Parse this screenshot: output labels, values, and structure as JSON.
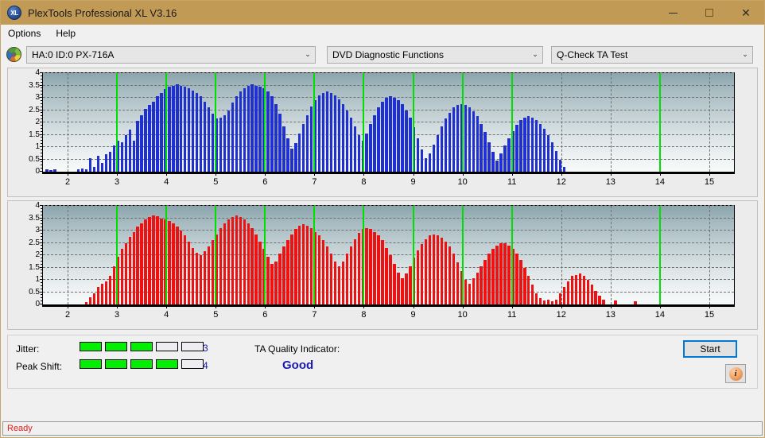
{
  "window": {
    "title": "PlexTools Professional XL V3.16",
    "app_icon": "XL",
    "minimize": "—",
    "maximize": "□",
    "close": "✕"
  },
  "menu": [
    {
      "label": "Options"
    },
    {
      "label": "Help"
    }
  ],
  "toolbar": {
    "drive_icon": "disc-icon",
    "drive_value": "HA:0 ID:0  PX-716A",
    "function_value": "DVD Diagnostic Functions",
    "test_value": "Q-Check TA Test",
    "chevron": "⌄"
  },
  "info": {
    "jitter_label": "Jitter:",
    "jitter_value": "3",
    "jitter_segments": 5,
    "jitter_filled": 3,
    "peak_label": "Peak Shift:",
    "peak_value": "4",
    "peak_segments": 5,
    "peak_filled": 4,
    "ta_label": "TA Quality Indicator:",
    "ta_value": "Good",
    "start_label": "Start",
    "info_glyph": "i",
    "colors": {
      "segment_on": "#00f000",
      "value_text": "#1a1ab0",
      "ta_text": "#1a1aaa",
      "accent": "#0078d7"
    }
  },
  "status": {
    "text": "Ready"
  },
  "chart_data": [
    {
      "type": "bar",
      "name": "jitter-chart",
      "title": "",
      "xlabel": "",
      "ylabel": "",
      "color": "#1f2fd0",
      "xlim": [
        1.5,
        15.5
      ],
      "ylim": [
        0,
        4
      ],
      "grid": true,
      "yticks": [
        0,
        0.5,
        1,
        1.5,
        2,
        2.5,
        3,
        3.5,
        4
      ],
      "xticks": [
        2,
        3,
        4,
        5,
        6,
        7,
        8,
        9,
        10,
        11,
        12,
        13,
        14,
        15
      ],
      "markers": [
        3,
        4,
        5,
        6,
        7,
        8,
        9,
        10,
        11,
        14
      ],
      "x": [
        1.58,
        1.66,
        1.74,
        1.82,
        1.9,
        1.98,
        2.06,
        2.14,
        2.22,
        2.3,
        2.38,
        2.46,
        2.54,
        2.62,
        2.7,
        2.78,
        2.86,
        2.94,
        3.02,
        3.1,
        3.18,
        3.26,
        3.34,
        3.42,
        3.5,
        3.58,
        3.66,
        3.74,
        3.82,
        3.9,
        3.98,
        4.06,
        4.14,
        4.22,
        4.3,
        4.38,
        4.46,
        4.54,
        4.62,
        4.7,
        4.78,
        4.86,
        4.94,
        5.02,
        5.1,
        5.18,
        5.26,
        5.34,
        5.42,
        5.5,
        5.58,
        5.66,
        5.74,
        5.82,
        5.9,
        5.98,
        6.06,
        6.14,
        6.22,
        6.3,
        6.38,
        6.46,
        6.54,
        6.62,
        6.7,
        6.78,
        6.86,
        6.94,
        7.02,
        7.1,
        7.18,
        7.26,
        7.34,
        7.42,
        7.5,
        7.58,
        7.66,
        7.74,
        7.82,
        7.9,
        7.98,
        8.06,
        8.14,
        8.22,
        8.3,
        8.38,
        8.46,
        8.54,
        8.62,
        8.7,
        8.78,
        8.86,
        8.94,
        9.02,
        9.1,
        9.18,
        9.26,
        9.34,
        9.42,
        9.5,
        9.58,
        9.66,
        9.74,
        9.82,
        9.9,
        9.98,
        10.06,
        10.14,
        10.22,
        10.3,
        10.38,
        10.46,
        10.54,
        10.62,
        10.7,
        10.78,
        10.86,
        10.94,
        11.02,
        11.1,
        11.18,
        11.26,
        11.34,
        11.42,
        11.5,
        11.58,
        11.66,
        11.74,
        11.82,
        11.9,
        11.98,
        12.06,
        12.14,
        12.22,
        12.3,
        12.38,
        12.46,
        12.54,
        12.62,
        12.7,
        12.78,
        12.86,
        12.94,
        13.02,
        13.1,
        13.18,
        13.26,
        13.34,
        13.42,
        13.5,
        13.58,
        13.66,
        13.74,
        13.82,
        13.9,
        13.98,
        14.06,
        14.14,
        14.22,
        14.3,
        14.38,
        14.46,
        14.54,
        14.62,
        14.7,
        14.78,
        14.86,
        14.94,
        15.02,
        15.1,
        15.18,
        15.26,
        15.34,
        15.42
      ],
      "values": [
        0.1,
        0.08,
        0.1,
        0.0,
        0.0,
        0.0,
        0.0,
        0.0,
        0.1,
        0.12,
        0.1,
        0.55,
        0.2,
        0.65,
        0.35,
        0.7,
        0.8,
        1.05,
        1.25,
        1.2,
        1.5,
        1.7,
        1.25,
        2.05,
        2.3,
        2.55,
        2.7,
        2.85,
        3.05,
        3.2,
        3.35,
        3.45,
        3.5,
        3.55,
        3.5,
        3.45,
        3.4,
        3.3,
        3.2,
        3.05,
        2.85,
        2.6,
        2.35,
        2.15,
        2.2,
        2.3,
        2.5,
        2.8,
        3.05,
        3.25,
        3.4,
        3.5,
        3.55,
        3.5,
        3.45,
        3.4,
        3.25,
        3.05,
        2.75,
        2.35,
        1.85,
        1.35,
        0.95,
        1.15,
        1.55,
        1.95,
        2.3,
        2.65,
        2.9,
        3.1,
        3.2,
        3.25,
        3.2,
        3.1,
        2.95,
        2.75,
        2.5,
        2.2,
        1.85,
        1.5,
        1.25,
        1.55,
        1.95,
        2.3,
        2.6,
        2.85,
        3.0,
        3.05,
        3.0,
        2.9,
        2.75,
        2.5,
        2.2,
        1.8,
        1.35,
        0.9,
        0.55,
        0.75,
        1.1,
        1.5,
        1.85,
        2.15,
        2.4,
        2.6,
        2.7,
        2.75,
        2.7,
        2.6,
        2.45,
        2.25,
        1.95,
        1.6,
        1.2,
        0.8,
        0.45,
        0.75,
        1.05,
        1.35,
        1.65,
        1.9,
        2.1,
        2.2,
        2.25,
        2.2,
        2.1,
        1.95,
        1.75,
        1.5,
        1.2,
        0.85,
        0.5,
        0.2,
        0.0,
        0.0,
        0.0,
        0.0,
        0.0,
        0.0,
        0.0,
        0.0,
        0.0,
        0.0,
        0.0,
        0.0,
        0.0,
        0.0,
        0.0,
        0.0,
        0.0,
        0.0,
        0.0,
        0.0,
        0.0,
        0.0,
        0.0,
        0.0,
        0.0,
        0.0,
        0.0,
        0.0,
        0.0,
        0.0,
        0.0,
        0.0,
        0.0,
        0.0,
        0.0,
        0.0,
        0.0,
        0.0,
        0.0,
        0.0,
        0.0,
        0.0,
        0.0,
        0.0
      ]
    },
    {
      "type": "bar",
      "name": "peak-shift-chart",
      "title": "",
      "xlabel": "",
      "ylabel": "",
      "color": "#ee1111",
      "xlim": [
        1.5,
        15.5
      ],
      "ylim": [
        0,
        4
      ],
      "grid": true,
      "yticks": [
        0,
        0.5,
        1,
        1.5,
        2,
        2.5,
        3,
        3.5,
        4
      ],
      "xticks": [
        2,
        3,
        4,
        5,
        6,
        7,
        8,
        9,
        10,
        11,
        12,
        13,
        14,
        15
      ],
      "markers": [
        3,
        4,
        5,
        6,
        7,
        8,
        9,
        10,
        11,
        14
      ],
      "x": [
        1.58,
        1.66,
        1.74,
        1.82,
        1.9,
        1.98,
        2.06,
        2.14,
        2.22,
        2.3,
        2.38,
        2.46,
        2.54,
        2.62,
        2.7,
        2.78,
        2.86,
        2.94,
        3.02,
        3.1,
        3.18,
        3.26,
        3.34,
        3.42,
        3.5,
        3.58,
        3.66,
        3.74,
        3.82,
        3.9,
        3.98,
        4.06,
        4.14,
        4.22,
        4.3,
        4.38,
        4.46,
        4.54,
        4.62,
        4.7,
        4.78,
        4.86,
        4.94,
        5.02,
        5.1,
        5.18,
        5.26,
        5.34,
        5.42,
        5.5,
        5.58,
        5.66,
        5.74,
        5.82,
        5.9,
        5.98,
        6.06,
        6.14,
        6.22,
        6.3,
        6.38,
        6.46,
        6.54,
        6.62,
        6.7,
        6.78,
        6.86,
        6.94,
        7.02,
        7.1,
        7.18,
        7.26,
        7.34,
        7.42,
        7.5,
        7.58,
        7.66,
        7.74,
        7.82,
        7.9,
        7.98,
        8.06,
        8.14,
        8.22,
        8.3,
        8.38,
        8.46,
        8.54,
        8.62,
        8.7,
        8.78,
        8.86,
        8.94,
        9.02,
        9.1,
        9.18,
        9.26,
        9.34,
        9.42,
        9.5,
        9.58,
        9.66,
        9.74,
        9.82,
        9.9,
        9.98,
        10.06,
        10.14,
        10.22,
        10.3,
        10.38,
        10.46,
        10.54,
        10.62,
        10.7,
        10.78,
        10.86,
        10.94,
        11.02,
        11.1,
        11.18,
        11.26,
        11.34,
        11.42,
        11.5,
        11.58,
        11.66,
        11.74,
        11.82,
        11.9,
        11.98,
        12.06,
        12.14,
        12.22,
        12.3,
        12.38,
        12.46,
        12.54,
        12.62,
        12.7,
        12.78,
        12.86,
        12.94,
        13.02,
        13.1,
        13.18,
        13.26,
        13.34,
        13.42,
        13.5,
        13.58,
        13.66,
        13.74,
        13.82,
        13.9,
        13.98,
        14.06,
        14.14,
        14.22,
        14.3,
        14.38,
        14.46,
        14.54,
        14.62,
        14.7,
        14.78,
        14.86,
        14.94,
        15.02,
        15.1,
        15.18,
        15.26,
        15.34,
        15.42
      ],
      "values": [
        0.0,
        0.0,
        0.0,
        0.0,
        0.0,
        0.0,
        0.0,
        0.0,
        0.0,
        0.0,
        0.1,
        0.3,
        0.45,
        0.7,
        0.85,
        0.95,
        1.15,
        1.55,
        1.95,
        2.25,
        2.5,
        2.75,
        2.95,
        3.15,
        3.3,
        3.45,
        3.55,
        3.6,
        3.58,
        3.5,
        3.45,
        3.4,
        3.3,
        3.15,
        3.0,
        2.8,
        2.55,
        2.3,
        2.1,
        2.0,
        2.15,
        2.35,
        2.6,
        2.85,
        3.1,
        3.3,
        3.45,
        3.55,
        3.6,
        3.55,
        3.45,
        3.3,
        3.1,
        2.85,
        2.55,
        2.25,
        1.95,
        1.65,
        1.75,
        2.05,
        2.35,
        2.6,
        2.85,
        3.05,
        3.2,
        3.25,
        3.2,
        3.1,
        2.95,
        2.8,
        2.6,
        2.35,
        2.05,
        1.75,
        1.55,
        1.75,
        2.05,
        2.35,
        2.65,
        2.9,
        3.05,
        3.1,
        3.05,
        2.95,
        2.8,
        2.6,
        2.3,
        2.0,
        1.65,
        1.3,
        1.05,
        1.25,
        1.55,
        1.9,
        2.2,
        2.45,
        2.65,
        2.8,
        2.85,
        2.8,
        2.7,
        2.55,
        2.35,
        2.05,
        1.7,
        1.35,
        1.0,
        0.85,
        1.05,
        1.3,
        1.55,
        1.8,
        2.05,
        2.25,
        2.4,
        2.5,
        2.5,
        2.4,
        2.25,
        2.05,
        1.8,
        1.5,
        1.15,
        0.8,
        0.45,
        0.25,
        0.15,
        0.18,
        0.12,
        0.2,
        0.45,
        0.7,
        0.95,
        1.15,
        1.2,
        1.25,
        1.15,
        1.0,
        0.8,
        0.55,
        0.35,
        0.2,
        0.0,
        0.0,
        0.15,
        0.0,
        0.0,
        0.0,
        0.0,
        0.12,
        0.0,
        0.0,
        0.0,
        0.0,
        0.0,
        0.0,
        0.0,
        0.0,
        0.0,
        0.0,
        0.0,
        0.0,
        0.0,
        0.0,
        0.0,
        0.0,
        0.0,
        0.0,
        0.0,
        0.0,
        0.0,
        0.0,
        0.0
      ]
    }
  ]
}
